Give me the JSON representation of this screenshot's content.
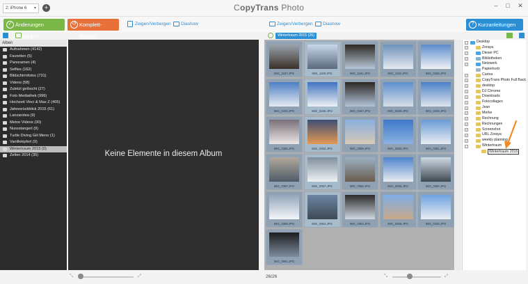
{
  "window": {
    "device": "2: iPhone 6",
    "title_prefix": "C",
    "title_bold": "opyTrans",
    "title_rest": " Photo",
    "controls": [
      "–",
      "□",
      "✕"
    ]
  },
  "toolbar": {
    "save_label": "Änderungen speichern",
    "backup_label": "Komplett-Backup",
    "left_toggle_label": "Zeigen/Verbergen",
    "left_slideshow_label": "Diashow",
    "right_toggle_label": "Zeigen/Verbergen",
    "right_slideshow_label": "Diashow",
    "help_label": "Kurzanleitungen"
  },
  "albums_panel": {
    "header": "Alben",
    "items": [
      {
        "label": "Aufnahmen (4142)",
        "icon": "camera-icon"
      },
      {
        "label": "Favoriten (5)",
        "icon": "heart-icon"
      },
      {
        "label": "Panoramen (4)",
        "icon": "panorama-icon"
      },
      {
        "label": "Selfies (162)",
        "icon": "user-icon"
      },
      {
        "label": "Bildschirmfotos (731)",
        "icon": "screenshot-icon"
      },
      {
        "label": "Videos (58)",
        "icon": "video-icon"
      },
      {
        "label": "Zuletzt gelöscht (27)",
        "icon": "trash-icon"
      },
      {
        "label": "Foto Mediathek (996)",
        "icon": "photo-library-icon"
      },
      {
        "label": "Hochzeit Vinci & Max Z (405)",
        "icon": "folder-icon"
      },
      {
        "label": "Jahresrückblick 2015 (61)",
        "icon": "folder-icon"
      },
      {
        "label": "Lanzarotea (9)",
        "icon": "folder-icon"
      },
      {
        "label": "Meine Videos (30)",
        "icon": "folder-icon"
      },
      {
        "label": "Nussstangerl (9)",
        "icon": "folder-icon"
      },
      {
        "label": "Turtle Diving Gili Meno (1)",
        "icon": "folder-icon"
      },
      {
        "label": "Vanillekipferl (9)",
        "icon": "folder-icon"
      },
      {
        "label": "Wintertraum 2015 (0)",
        "icon": "folder-icon"
      },
      {
        "label": "Zelten 2014 (35)",
        "icon": "folder-icon"
      }
    ],
    "selected_index": 15
  },
  "empty_album": {
    "message": "Keine Elemente in diesem Album"
  },
  "photos_panel": {
    "album_chip": "Wintertraum 2015 (26)",
    "status": "26/26",
    "photos": [
      {
        "name": "IMG_1187.JPG",
        "top": "#9aa3ad",
        "bottom": "#3a3028"
      },
      {
        "name": "IMG_1188.JPG",
        "top": "#c8d8ea",
        "bottom": "#5a6a7c"
      },
      {
        "name": "IMG_1191.JPG",
        "top": "#2d2722",
        "bottom": "#b7c7d8"
      },
      {
        "name": "IMG_1192.JPG",
        "top": "#6f92bb",
        "bottom": "#e4eaf0"
      },
      {
        "name": "IMG_0338.JPG",
        "top": "#5c8ccc",
        "bottom": "#f0f2f5"
      },
      {
        "name": "IMG_0340.JPG",
        "top": "#4c7fc4",
        "bottom": "#e6ebf0"
      },
      {
        "name": "IMG_0346.JPG",
        "top": "#3f73bf",
        "bottom": "#eef0f3"
      },
      {
        "name": "IMG_0347.JPG",
        "top": "#2b2622",
        "bottom": "#b2c4d8"
      },
      {
        "name": "IMG_0348.JPG",
        "top": "#5e8fce",
        "bottom": "#d9dee4"
      },
      {
        "name": "IMG_0345.JPG",
        "top": "#4b82c8",
        "bottom": "#dfe4ea"
      },
      {
        "name": "IMG_0356.JPG",
        "top": "#7a6f78",
        "bottom": "#ece6e6"
      },
      {
        "name": "IMG_0353.JPG",
        "top": "#3e4e74",
        "bottom": "#e39a52"
      },
      {
        "name": "IMG_0399.JPG",
        "top": "#8ab0e0",
        "bottom": "#d8c9b6"
      },
      {
        "name": "IMG_0390.JPG",
        "top": "#3d78c8",
        "bottom": "#8cb2e2"
      },
      {
        "name": "IMG_0361.JPG",
        "top": "#6a9bd6",
        "bottom": "#e9edf2"
      },
      {
        "name": "IMG_0367.JPG",
        "top": "#b1a89a",
        "bottom": "#4f5c68"
      },
      {
        "name": "IMG_0357.JPG",
        "top": "#7f8f9e",
        "bottom": "#f0f2f4"
      },
      {
        "name": "IMG_0358.JPG",
        "top": "#9bb0c2",
        "bottom": "#6b5d4e"
      },
      {
        "name": "IMG_0356.JPG",
        "top": "#4d84cc",
        "bottom": "#e9edf0"
      },
      {
        "name": "IMG_0350.JPG",
        "top": "#cfd9e4",
        "bottom": "#3e4a52"
      },
      {
        "name": "IMG_0359.JPG",
        "top": "#92a6bb",
        "bottom": "#f4f6f8"
      },
      {
        "name": "IMG_0364.JPG",
        "top": "#6a84a2",
        "bottom": "#3f4b55"
      },
      {
        "name": "IMG_0362.JPG",
        "top": "#2c2a2a",
        "bottom": "#cfd8e2"
      },
      {
        "name": "IMG_0365.JPG",
        "top": "#7faee6",
        "bottom": "#c8a88a"
      },
      {
        "name": "IMG_0345.JPG",
        "top": "#6da2e0",
        "bottom": "#eaeef2"
      },
      {
        "name": "IMG_0981.JPG",
        "top": "#1e1d1e",
        "bottom": "#7d8da0"
      }
    ]
  },
  "folder_tree": {
    "nodes": [
      {
        "label": "Desktop",
        "depth": 0,
        "expander": "−",
        "icon": "desktop-icon"
      },
      {
        "label": "Zoraya",
        "depth": 1,
        "expander": "+",
        "icon": "folder-icon"
      },
      {
        "label": "Dieser PC",
        "depth": 1,
        "expander": "+",
        "icon": "computer-icon"
      },
      {
        "label": "Bibliotheken",
        "depth": 1,
        "expander": "+",
        "icon": "library-icon"
      },
      {
        "label": "Netzwerk",
        "depth": 1,
        "expander": "+",
        "icon": "network-icon"
      },
      {
        "label": "Papierkorb",
        "depth": 1,
        "expander": "",
        "icon": "recycle-bin-icon"
      },
      {
        "label": "Carina",
        "depth": 1,
        "expander": "+",
        "icon": "folder-icon"
      },
      {
        "label": "CopyTrans Photo Full Backup",
        "depth": 1,
        "expander": "+",
        "icon": "folder-icon"
      },
      {
        "label": "desktop",
        "depth": 1,
        "expander": "+",
        "icon": "folder-icon"
      },
      {
        "label": "DJ Chrome",
        "depth": 1,
        "expander": "+",
        "icon": "folder-icon"
      },
      {
        "label": "Downloads",
        "depth": 1,
        "expander": "+",
        "icon": "folder-icon"
      },
      {
        "label": "Fotocollagen",
        "depth": 1,
        "expander": "+",
        "icon": "folder-icon"
      },
      {
        "label": "Jean",
        "depth": 1,
        "expander": "+",
        "icon": "folder-icon"
      },
      {
        "label": "Merke",
        "depth": 1,
        "expander": "+",
        "icon": "folder-icon"
      },
      {
        "label": "Rechnung",
        "depth": 1,
        "expander": "+",
        "icon": "folder-icon"
      },
      {
        "label": "Rechnungen",
        "depth": 1,
        "expander": "+",
        "icon": "folder-icon"
      },
      {
        "label": "Screenshot",
        "depth": 1,
        "expander": "+",
        "icon": "folder-icon"
      },
      {
        "label": "URL Zoraya",
        "depth": 1,
        "expander": "+",
        "icon": "folder-icon"
      },
      {
        "label": "weekly planning",
        "depth": 1,
        "expander": "+",
        "icon": "folder-icon"
      },
      {
        "label": "Wintertraum",
        "depth": 1,
        "expander": "−",
        "icon": "folder-icon"
      },
      {
        "label": "Wintertraum 2015",
        "depth": 2,
        "expander": "",
        "icon": "folder-icon",
        "renaming": true
      }
    ]
  },
  "colors": {
    "accent_green": "#7ab648",
    "accent_orange": "#e8713a",
    "accent_blue": "#2a8fd4",
    "arrow": "#f08a24"
  }
}
